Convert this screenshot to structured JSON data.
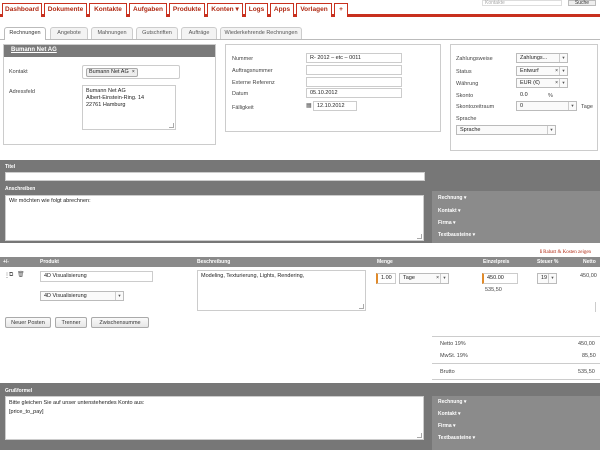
{
  "nav": {
    "items": [
      "Dashboard",
      "Dokumente",
      "Kontakte",
      "Aufgaben",
      "Produkte",
      "Konten ▾",
      "Logs",
      "Apps",
      "Vorlagen",
      "+"
    ],
    "search_placeholder": "Kontakte",
    "search_button": "Suche"
  },
  "tabs": [
    "Rechnungen",
    "Angebote",
    "Mahnungen",
    "Gutschriften",
    "Aufträge",
    "Wiederkehrende Rechnungen"
  ],
  "contact_panel": {
    "title": "Bumann Net AG",
    "contact_label": "Kontakt",
    "contact_token": "Bumann Net AG",
    "address_label": "Adressfeld",
    "address_lines": [
      "Bumann Net AG",
      "Albert-Einstein-Ring. 14",
      "22761 Hamburg"
    ]
  },
  "details_panel": {
    "nummer_label": "Nummer",
    "nummer_value": "R- 2012 – etc – 0011",
    "auftrag_label": "Auftragsnummer",
    "extref_label": "Externe Referenz",
    "datum_label": "Datum",
    "datum_value": "05.10.2012",
    "faellig_label": "Fälligkeit",
    "faellig_value": "12.10.2012"
  },
  "payment_panel": {
    "zahlungsweise_label": "Zahlungsweise",
    "zahlungsweise_value": "Zahlungs...",
    "status_label": "Status",
    "status_value": "Entwurf",
    "waehrung_label": "Währung",
    "waehrung_value": "EUR (€)",
    "skonto_label": "Skonto",
    "skonto_value": "0.0",
    "skonto_unit": "%",
    "skontozeitraum_label": "Skontozeitraum",
    "skontozeitraum_value": "0",
    "skontozeitraum_unit": "Tage",
    "sprache_label": "Sprache",
    "sprache_value": "Sprache"
  },
  "titel_label": "Titel",
  "anschreiben": {
    "label": "Anschreiben",
    "text": "Wir möchten wie folgt abrechnen:"
  },
  "side_links_1": [
    "Rechnung",
    "Kontakt",
    "Firma",
    "Textbausteine"
  ],
  "rabatt_link": "Rabatt & Kosten zeigen",
  "positions": {
    "headers": {
      "add": "+/-",
      "produkt": "Produkt",
      "beschreibung": "Beschreibung",
      "menge": "Menge",
      "einzelpreis": "Einzelpreis",
      "steuer": "Steuer %",
      "netto": "Netto"
    },
    "row": {
      "produkt": "4D Visualisierung",
      "produkt_select": "4D Visualisierung",
      "beschreibung": "Modeling, Texturierung, Lights, Rendering,",
      "menge": "1.00",
      "einheit": "Tage",
      "einzelpreis": "450.00",
      "brutto": "535,50",
      "steuer": "19",
      "netto": "450,00"
    }
  },
  "buttons": {
    "neuer_posten": "Neuer Posten",
    "trenner": "Trenner",
    "zwischensumme": "Zwischensumme"
  },
  "totals": {
    "netto_label": "Netto 19%",
    "netto_value": "450,00",
    "mwst_label": "MwSt. 19%",
    "mwst_value": "85,50",
    "brutto_label": "Brutto",
    "brutto_value": "535,50"
  },
  "grussformel": {
    "label": "Grußformel",
    "line1": "Bitte gleichen Sie auf unser untenstehendes Konto aus:",
    "line2": "[price_to_pay]"
  },
  "side_links_2": [
    "Rechnung",
    "Kontakt",
    "Firma",
    "Textbausteine"
  ],
  "colors": {
    "accent": "#c8301e",
    "bar": "#777777",
    "side": "#8b8b8b"
  }
}
